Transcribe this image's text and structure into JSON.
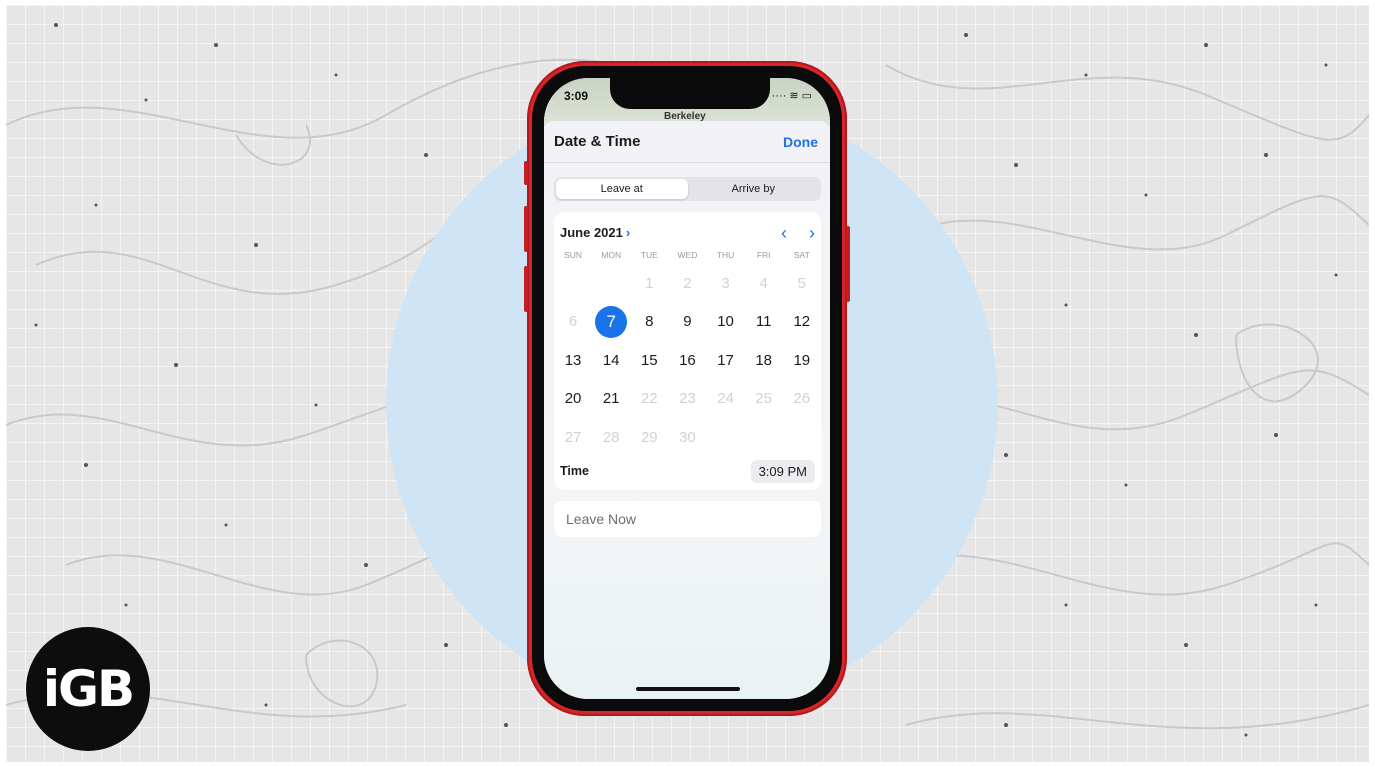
{
  "brand": {
    "logo_text": "iGB"
  },
  "status_bar": {
    "time": "3:09",
    "right": "···· ≋ ▭"
  },
  "map": {
    "label": "Berkeley"
  },
  "sheet": {
    "title": "Date & Time",
    "done_label": "Done"
  },
  "segmented_control": {
    "options": [
      "Leave at",
      "Arrive by"
    ],
    "selected": "Leave at"
  },
  "calendar": {
    "month_label": "June 2021",
    "weekdays": [
      "SUN",
      "MON",
      "TUE",
      "WED",
      "THU",
      "FRI",
      "SAT"
    ],
    "weeks": [
      [
        "",
        "",
        "1",
        "2",
        "3",
        "4",
        "5"
      ],
      [
        "6",
        "7",
        "8",
        "9",
        "10",
        "11",
        "12"
      ],
      [
        "13",
        "14",
        "15",
        "16",
        "17",
        "18",
        "19"
      ],
      [
        "20",
        "21",
        "22",
        "23",
        "24",
        "25",
        "26"
      ],
      [
        "27",
        "28",
        "29",
        "30",
        "",
        "",
        ""
      ]
    ],
    "selected_day": "7",
    "available_days": [
      "7",
      "8",
      "9",
      "10",
      "11",
      "12",
      "13",
      "14",
      "15",
      "16",
      "17",
      "18",
      "19",
      "20",
      "21"
    ]
  },
  "time": {
    "label": "Time",
    "value": "3:09 PM"
  },
  "leave_now": {
    "label": "Leave Now"
  },
  "colors": {
    "accent": "#1a73e8",
    "phone_frame": "#d9252a",
    "circle": "#cfe4f4"
  }
}
